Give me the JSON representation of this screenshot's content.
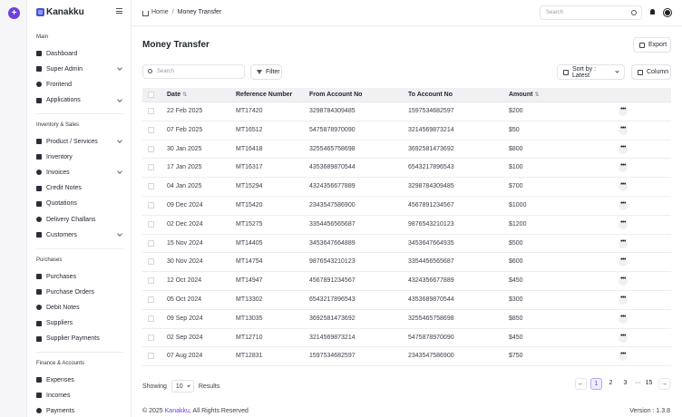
{
  "app": {
    "name": "Kanakku"
  },
  "sidebar": {
    "sections": [
      {
        "title": "Main",
        "items": [
          {
            "label": "Dashboard",
            "expandable": false
          },
          {
            "label": "Super Admin",
            "expandable": true
          },
          {
            "label": "Frontend",
            "expandable": false
          },
          {
            "label": "Applications",
            "expandable": true
          }
        ]
      },
      {
        "title": "Inventory & Sales",
        "items": [
          {
            "label": "Product / Services",
            "expandable": true
          },
          {
            "label": "Inventory",
            "expandable": false
          },
          {
            "label": "Invoices",
            "expandable": true
          },
          {
            "label": "Credit Notes",
            "expandable": false
          },
          {
            "label": "Quotations",
            "expandable": false
          },
          {
            "label": "Delivery Challans",
            "expandable": false
          },
          {
            "label": "Customers",
            "expandable": true
          }
        ]
      },
      {
        "title": "Purchases",
        "items": [
          {
            "label": "Purchases",
            "expandable": false
          },
          {
            "label": "Purchase Orders",
            "expandable": false
          },
          {
            "label": "Debit Notes",
            "expandable": false
          },
          {
            "label": "Suppliers",
            "expandable": false
          },
          {
            "label": "Supplier Payments",
            "expandable": false
          }
        ]
      },
      {
        "title": "Finance & Accounts",
        "items": [
          {
            "label": "Expenses",
            "expandable": false
          },
          {
            "label": "Incomes",
            "expandable": false
          },
          {
            "label": "Payments",
            "expandable": false
          }
        ]
      }
    ]
  },
  "topbar": {
    "breadcrumb": {
      "home": "Home",
      "separator": "/",
      "current": "Money Transfer"
    },
    "search_placeholder": "Search"
  },
  "page": {
    "title": "Money Transfer",
    "export_label": "Export",
    "search_placeholder": "Search",
    "filter_label": "Filter",
    "sort_label": "Sort by : Latest",
    "column_label": "Column"
  },
  "table": {
    "columns": [
      "Date",
      "Reference Number",
      "From Account No",
      "To Account No",
      "Amount"
    ],
    "rows": [
      [
        "22 Feb 2025",
        "MT17420",
        "3298784309485",
        "1597534682597",
        "$200"
      ],
      [
        "07 Feb 2025",
        "MT16512",
        "5475878970090",
        "3214569873214",
        "$50"
      ],
      [
        "30 Jan 2025",
        "MT16418",
        "3255465758698",
        "3692581473692",
        "$800"
      ],
      [
        "17 Jan 2025",
        "MT16317",
        "4353689870544",
        "6543217896543",
        "$100"
      ],
      [
        "04 Jan 2025",
        "MT15294",
        "4324356677889",
        "3298784309485",
        "$700"
      ],
      [
        "09 Dec 2024",
        "MT15420",
        "2343547586900",
        "4567891234567",
        "$1000"
      ],
      [
        "02 Dec 2024",
        "MT15275",
        "3354456565687",
        "9876543210123",
        "$1200"
      ],
      [
        "15 Nov 2024",
        "MT14405",
        "3453647664889",
        "3453647664935",
        "$500"
      ],
      [
        "30 Nov 2024",
        "MT14754",
        "9876543210123",
        "3354456565687",
        "$600"
      ],
      [
        "12 Oct 2024",
        "MT14947",
        "4567891234567",
        "4324356677889",
        "$450"
      ],
      [
        "05 Oct 2024",
        "MT13302",
        "6543217896543",
        "4353689870544",
        "$300"
      ],
      [
        "09 Sep 2024",
        "MT13035",
        "3692581473692",
        "3255465758698",
        "$850"
      ],
      [
        "02 Sep 2024",
        "MT12710",
        "3214569873214",
        "5475878970090",
        "$450"
      ],
      [
        "07 Aug 2024",
        "MT12831",
        "1597534682597",
        "2343547586900",
        "$750"
      ]
    ]
  },
  "pagination": {
    "showing_label": "Showing",
    "per_page": "10",
    "results_label": "Results",
    "prev": "←",
    "pages": [
      "1",
      "2",
      "3"
    ],
    "ellipsis": "···",
    "last": "15",
    "next": "→",
    "active_page": "1"
  },
  "footer": {
    "prefix": "© 2025",
    "brand": "Kanakku",
    "suffix": ", All Rights Reserved",
    "version": "Version : 1.3.8"
  },
  "colors": {
    "accent": "#6d3fe0",
    "brand": "#4b4dd6"
  }
}
